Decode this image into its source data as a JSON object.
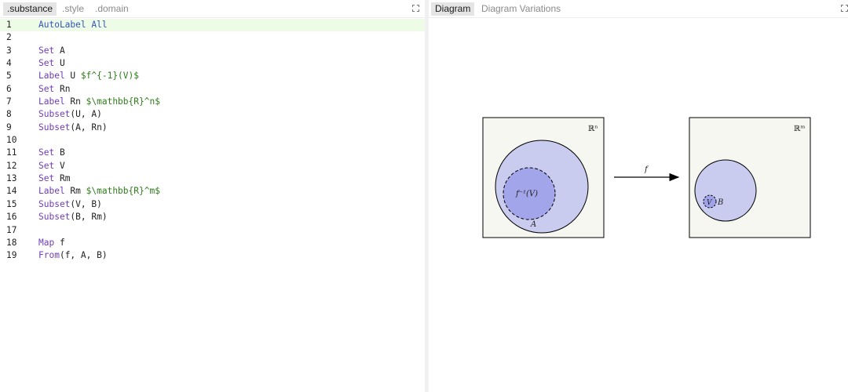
{
  "editor": {
    "tabs": [
      {
        "label": ".substance",
        "active": true
      },
      {
        "label": ".style",
        "active": false
      },
      {
        "label": ".domain",
        "active": false
      }
    ],
    "current_line": 1,
    "lines": [
      {
        "n": "1",
        "tokens": [
          {
            "t": "AutoLabel All",
            "c": "auto"
          }
        ]
      },
      {
        "n": "2",
        "tokens": []
      },
      {
        "n": "3",
        "tokens": [
          {
            "t": "Set",
            "c": "kw"
          },
          {
            "t": " A",
            "c": "id"
          }
        ]
      },
      {
        "n": "4",
        "tokens": [
          {
            "t": "Set",
            "c": "kw"
          },
          {
            "t": " U",
            "c": "id"
          }
        ]
      },
      {
        "n": "5",
        "tokens": [
          {
            "t": "Label",
            "c": "kw"
          },
          {
            "t": " U ",
            "c": "id"
          },
          {
            "t": "$f^{-1}(V)$",
            "c": "str"
          }
        ]
      },
      {
        "n": "6",
        "tokens": [
          {
            "t": "Set",
            "c": "kw"
          },
          {
            "t": " Rn",
            "c": "id"
          }
        ]
      },
      {
        "n": "7",
        "tokens": [
          {
            "t": "Label",
            "c": "kw"
          },
          {
            "t": " Rn ",
            "c": "id"
          },
          {
            "t": "$\\mathbb{R}^n$",
            "c": "str"
          }
        ]
      },
      {
        "n": "8",
        "tokens": [
          {
            "t": "Subset",
            "c": "fn"
          },
          {
            "t": "(U, A)",
            "c": "id"
          }
        ]
      },
      {
        "n": "9",
        "tokens": [
          {
            "t": "Subset",
            "c": "fn"
          },
          {
            "t": "(A, Rn)",
            "c": "id"
          }
        ]
      },
      {
        "n": "10",
        "tokens": []
      },
      {
        "n": "11",
        "tokens": [
          {
            "t": "Set",
            "c": "kw"
          },
          {
            "t": " B",
            "c": "id"
          }
        ]
      },
      {
        "n": "12",
        "tokens": [
          {
            "t": "Set",
            "c": "kw"
          },
          {
            "t": " V",
            "c": "id"
          }
        ]
      },
      {
        "n": "13",
        "tokens": [
          {
            "t": "Set",
            "c": "kw"
          },
          {
            "t": " Rm",
            "c": "id"
          }
        ]
      },
      {
        "n": "14",
        "tokens": [
          {
            "t": "Label",
            "c": "kw"
          },
          {
            "t": " Rm ",
            "c": "id"
          },
          {
            "t": "$\\mathbb{R}^m$",
            "c": "str"
          }
        ]
      },
      {
        "n": "15",
        "tokens": [
          {
            "t": "Subset",
            "c": "fn"
          },
          {
            "t": "(V, B)",
            "c": "id"
          }
        ]
      },
      {
        "n": "16",
        "tokens": [
          {
            "t": "Subset",
            "c": "fn"
          },
          {
            "t": "(B, Rm)",
            "c": "id"
          }
        ]
      },
      {
        "n": "17",
        "tokens": []
      },
      {
        "n": "18",
        "tokens": [
          {
            "t": "Map",
            "c": "kw"
          },
          {
            "t": " f",
            "c": "id"
          }
        ]
      },
      {
        "n": "19",
        "tokens": [
          {
            "t": "From",
            "c": "fn"
          },
          {
            "t": "(f, A, B)",
            "c": "id"
          }
        ]
      }
    ]
  },
  "preview": {
    "tabs": [
      {
        "label": "Diagram",
        "active": true
      },
      {
        "label": "Diagram Variations",
        "active": false
      }
    ],
    "diagram": {
      "label_Rn": "ℝⁿ",
      "label_Rm": "ℝᵐ",
      "label_A": "A",
      "label_U": "f⁻¹(V)",
      "label_f": "f",
      "label_V": "V",
      "label_B": "B",
      "colors": {
        "box_fill": "#f6f7f1",
        "set_fill": "#c9cbef",
        "subset_fill": "#a3a5ea",
        "small_fill": "#a0a2ea"
      }
    }
  }
}
